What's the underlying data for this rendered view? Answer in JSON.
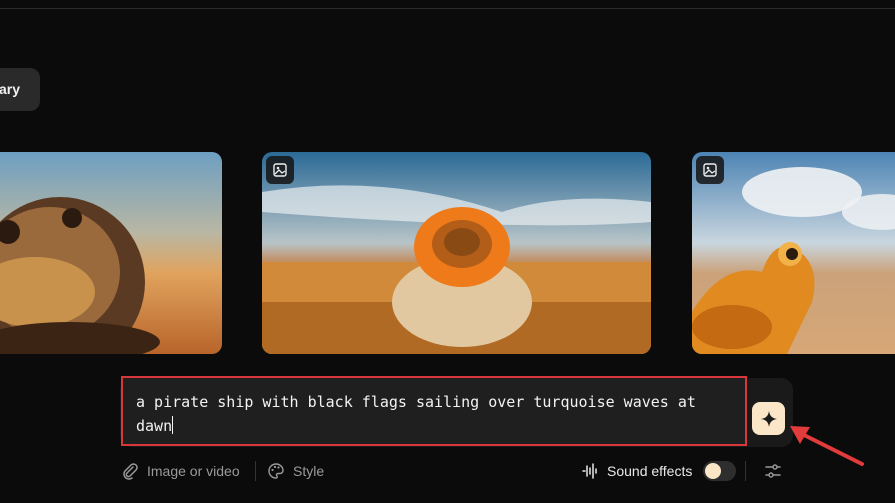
{
  "sidebar": {
    "library_label": "ary"
  },
  "gallery": {
    "items": [
      {
        "alt": "toad in desert",
        "badge_icon": "image-icon"
      },
      {
        "alt": "orange desert flower",
        "badge_icon": "image-icon"
      },
      {
        "alt": "orange frog in desert",
        "badge_icon": "image-icon"
      }
    ]
  },
  "composer": {
    "prompt_value": "a pirate ship with black flags sailing over turquoise waves at dawn",
    "generate_icon": "sparkle-icon"
  },
  "toolbar": {
    "attach_label": "Image or video",
    "style_label": "Style",
    "sound_effects_label": "Sound effects",
    "sound_effects_on": false,
    "settings_icon": "sliders-icon"
  },
  "annotations": {
    "highlight_color": "#d9373a"
  }
}
